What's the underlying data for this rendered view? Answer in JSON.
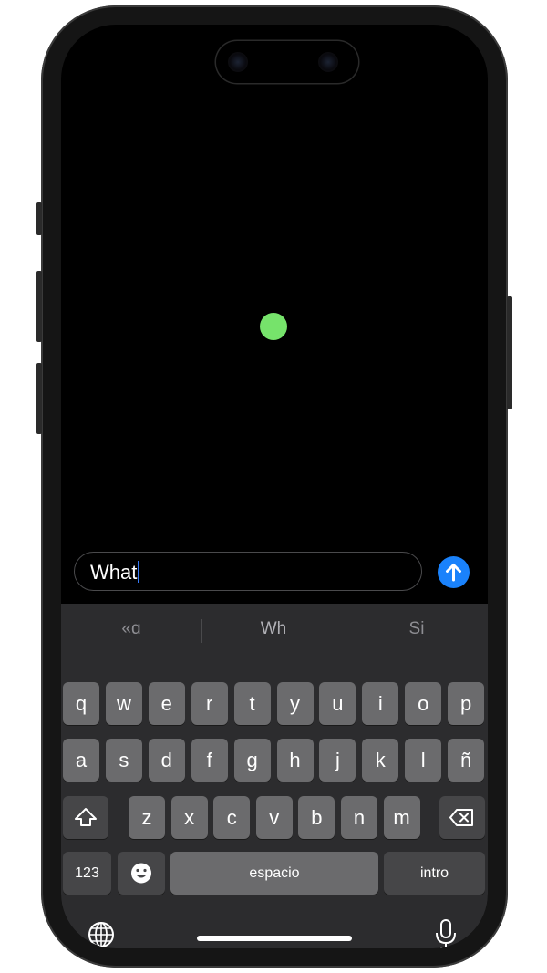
{
  "colors": {
    "dot": "#76e36b",
    "send_button": "#1a82fb",
    "caret": "#3478f6",
    "keyboard_bg": "#2c2c2e"
  },
  "canvas": {
    "dot_icon": "green-circle"
  },
  "input": {
    "value": "What"
  },
  "send": {
    "icon": "arrow-up-icon"
  },
  "suggestions": [
    "«ɑ",
    "Wh",
    "Si"
  ],
  "keyboard": {
    "row1": [
      "q",
      "w",
      "e",
      "r",
      "t",
      "y",
      "u",
      "i",
      "o",
      "p"
    ],
    "row2": [
      "a",
      "s",
      "d",
      "f",
      "g",
      "h",
      "j",
      "k",
      "l",
      "ñ"
    ],
    "row3": [
      "z",
      "x",
      "c",
      "v",
      "b",
      "n",
      "m"
    ],
    "shift_icon": "shift-icon",
    "delete_icon": "backspace-icon",
    "numbers_label": "123",
    "emoji_icon": "emoji-icon",
    "space_label": "espacio",
    "return_label": "intro",
    "globe_icon": "globe-icon",
    "mic_icon": "microphone-icon"
  }
}
